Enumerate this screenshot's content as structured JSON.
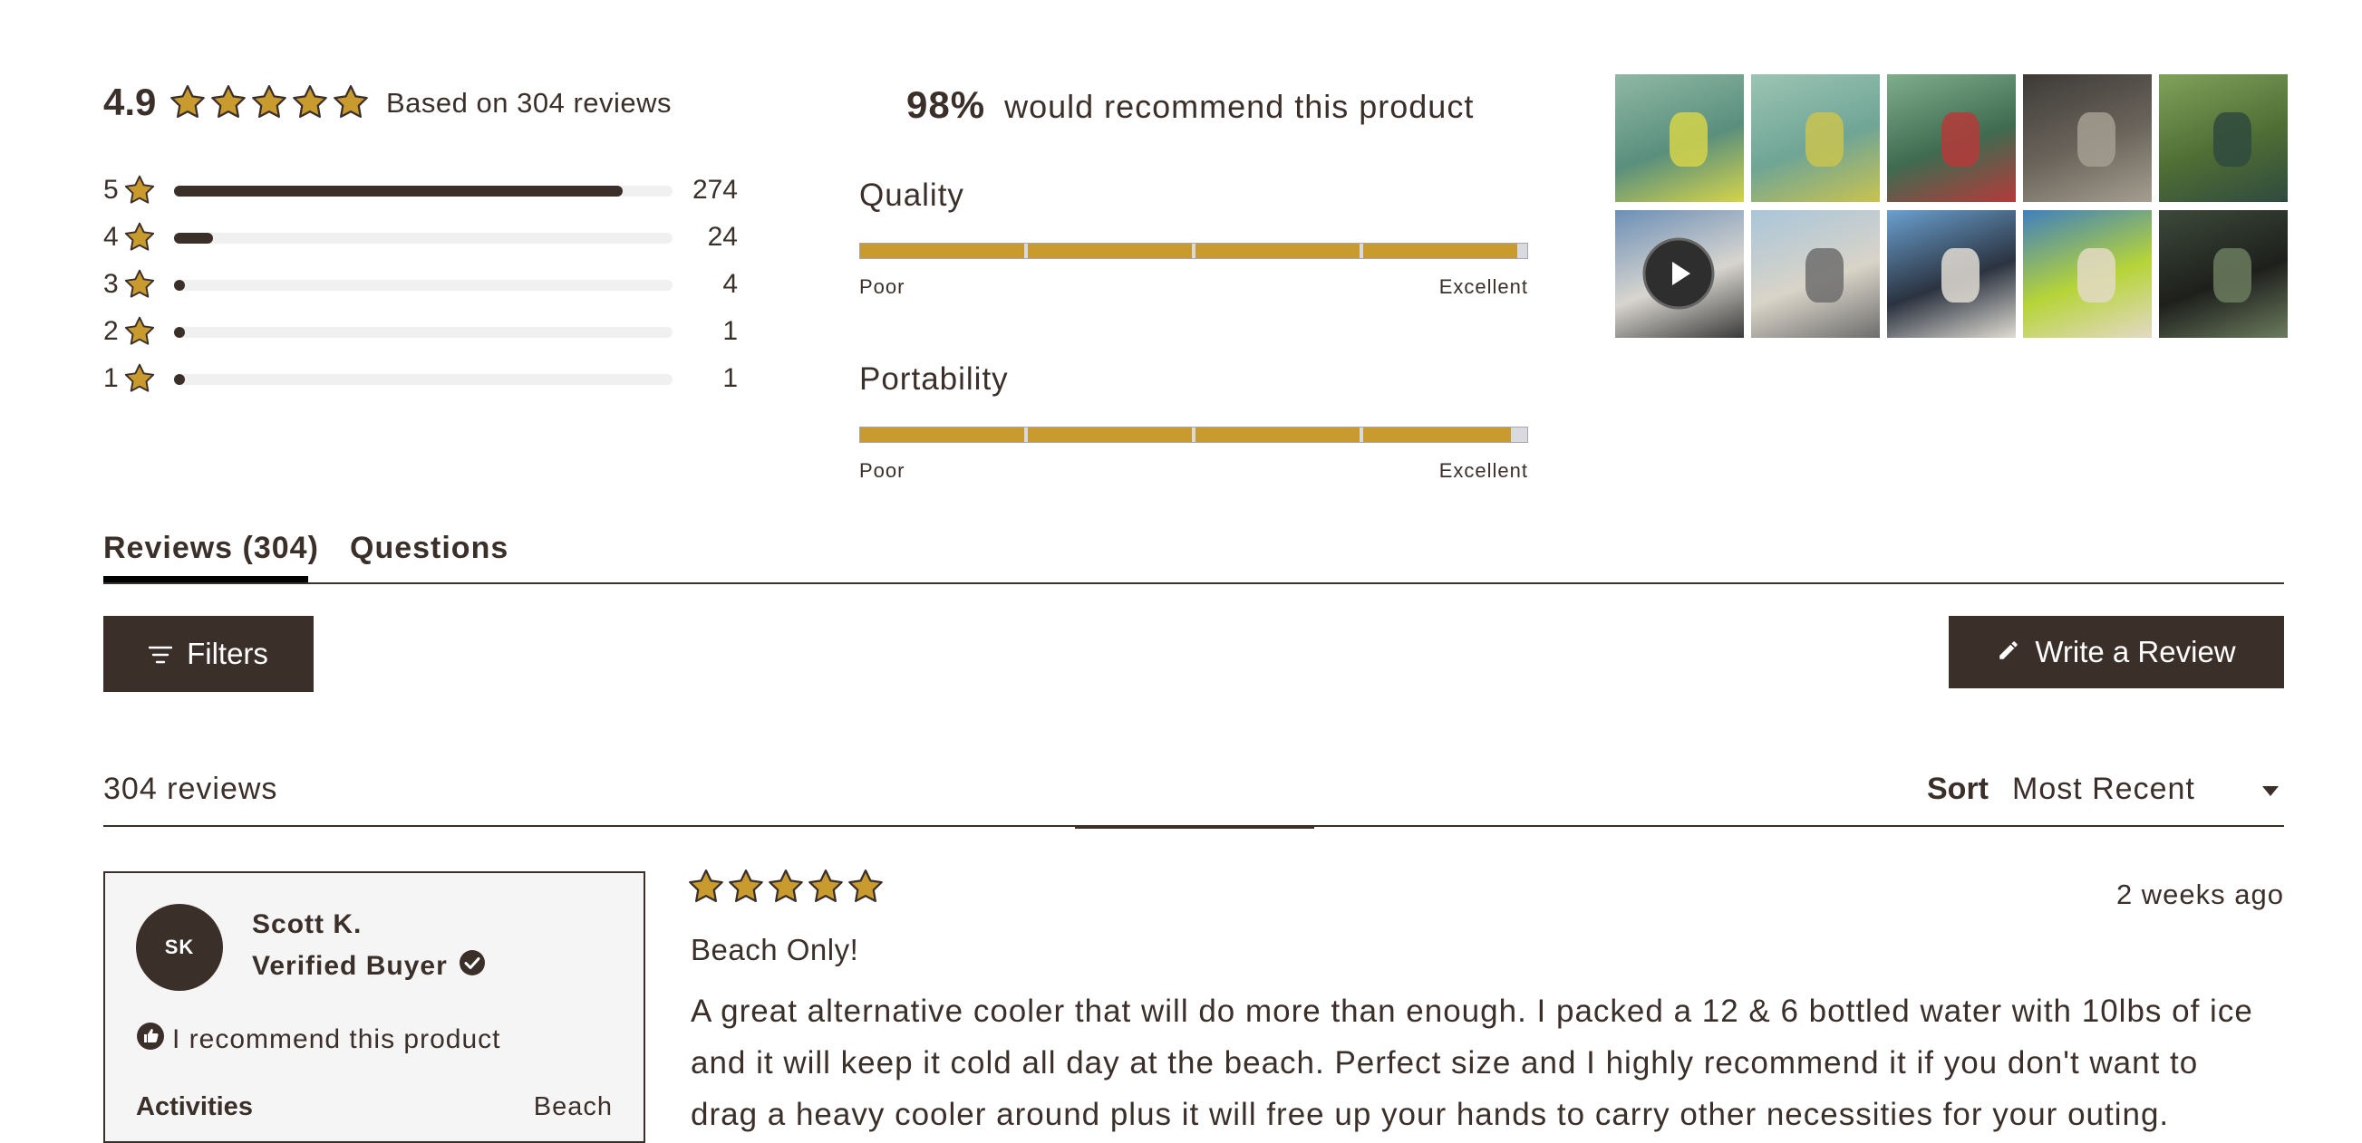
{
  "summary": {
    "average": "4.9",
    "based_on": "Based on 304 reviews",
    "stars": 5,
    "distribution": [
      {
        "label": "5",
        "count": "274",
        "fraction": 0.9
      },
      {
        "label": "4",
        "count": "24",
        "fraction": 0.078
      },
      {
        "label": "3",
        "count": "4",
        "fraction": 0.013
      },
      {
        "label": "2",
        "count": "1",
        "fraction": 0.003
      },
      {
        "label": "1",
        "count": "1",
        "fraction": 0.003
      }
    ]
  },
  "recommend": {
    "percent": "98%",
    "text": "would recommend this product"
  },
  "attributes": [
    {
      "title": "Quality",
      "low": "Poor",
      "high": "Excellent",
      "score_fraction": 0.985
    },
    {
      "title": "Portability",
      "low": "Poor",
      "high": "Excellent",
      "score_fraction": 0.975
    }
  ],
  "media": {
    "thumbnails": [
      {
        "name": "lake-cooler-floating",
        "colors": [
          "#8fb8a5",
          "#5a8f7d",
          "#d5d44a"
        ]
      },
      {
        "name": "shallow-water-cooler",
        "colors": [
          "#9cc4b4",
          "#6fa595",
          "#c9c350"
        ]
      },
      {
        "name": "person-kayak-water",
        "colors": [
          "#7fae8c",
          "#3f6b50",
          "#b53a3a"
        ]
      },
      {
        "name": "icemule-bag-closeup",
        "colors": [
          "#3d3a36",
          "#6b655c",
          "#a59e90"
        ]
      },
      {
        "name": "child-with-backpack",
        "colors": [
          "#7fa25a",
          "#4f6e35",
          "#2f4a3e"
        ]
      },
      {
        "name": "video-beach-water",
        "colors": [
          "#6c8fb6",
          "#d8d5cf",
          "#3a3a3a"
        ],
        "is_video": true
      },
      {
        "name": "beach-gray-cooler",
        "colors": [
          "#a9c5d9",
          "#d9d4c8",
          "#6d6d6d"
        ]
      },
      {
        "name": "icemule-cooler-beach",
        "colors": [
          "#6aa0cf",
          "#2b3340",
          "#e0dcd3"
        ]
      },
      {
        "name": "green-cooler-beach",
        "colors": [
          "#3f7fbf",
          "#b6d438",
          "#e3d9c5"
        ]
      },
      {
        "name": "truck-bed-cooler",
        "colors": [
          "#3c4a3a",
          "#1e1f1c",
          "#6b7c5e"
        ]
      }
    ]
  },
  "tabs": [
    {
      "label": "Reviews (304)",
      "active": true
    },
    {
      "label": "Questions",
      "active": false
    }
  ],
  "toolbar": {
    "filters_label": "Filters",
    "write_review_label": "Write a Review"
  },
  "list_header": {
    "count": "304 reviews",
    "sort_label": "Sort",
    "sort_value": "Most Recent"
  },
  "review": {
    "initials": "SK",
    "author": "Scott K.",
    "verified": "Verified Buyer",
    "recommend": "I recommend this product",
    "attribute_label": "Activities",
    "attribute_value": "Beach",
    "stars": 5,
    "date": "2 weeks ago",
    "title": "Beach Only!",
    "body_lines": [
      "A great alternative cooler that will do more than enough. I packed a 12 & 6 bottled water with 10lbs of ice",
      "and it will keep it cold all day at the beach. Perfect size and I highly recommend it if you don't want to",
      "drag a heavy cooler around plus it will free up your hands to carry other necessities for your outing."
    ]
  },
  "colors": {
    "brand_dark": "#3b2f2a",
    "star_gold": "#c99a2e",
    "bar_track": "#f1f0f0"
  }
}
